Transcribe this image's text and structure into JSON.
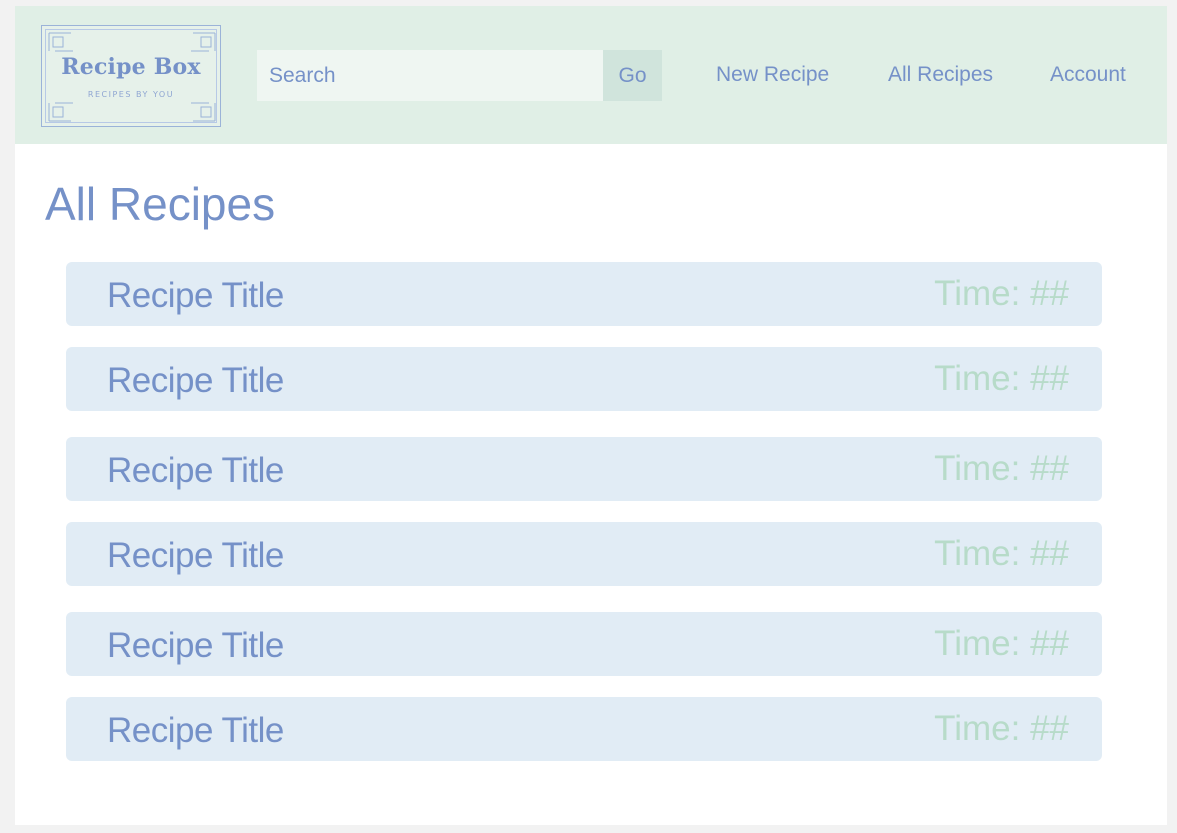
{
  "header": {
    "logo": {
      "title": "Recipe Box",
      "subtitle": "RECIPES BY YOU"
    },
    "search": {
      "placeholder": "Search",
      "button_label": "Go"
    },
    "nav": [
      "New Recipe",
      "All Recipes",
      "Account"
    ]
  },
  "main": {
    "title": "All Recipes",
    "recipes": [
      {
        "title": "Recipe Title",
        "time": "Time: ##"
      },
      {
        "title": "Recipe Title",
        "time": "Time: ##"
      },
      {
        "title": "Recipe Title",
        "time": "Time: ##"
      },
      {
        "title": "Recipe Title",
        "time": "Time: ##"
      },
      {
        "title": "Recipe Title",
        "time": "Time: ##"
      },
      {
        "title": "Recipe Title",
        "time": "Time: ##"
      }
    ]
  },
  "colors": {
    "header_bg": "#e0efe6",
    "primary_text": "#7591c8",
    "time_text": "#b7dbc9",
    "row_bg": "#e1ecf5"
  }
}
